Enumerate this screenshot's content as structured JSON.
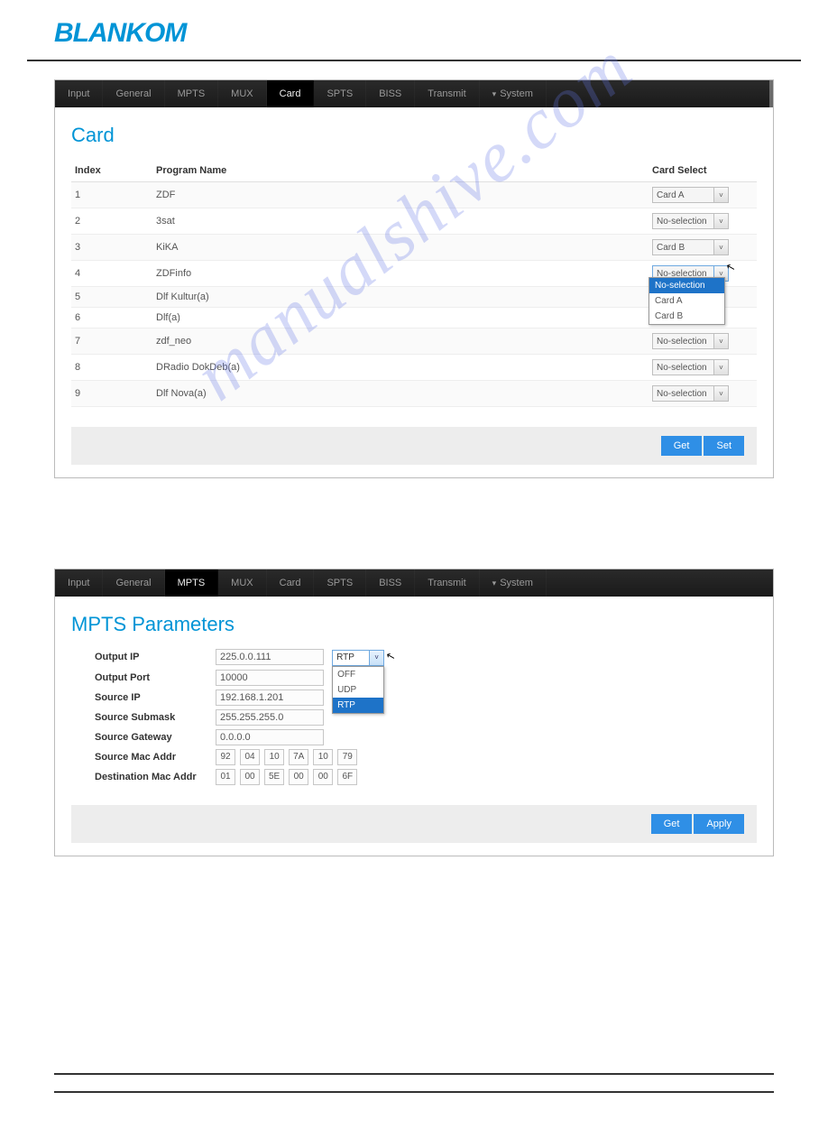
{
  "logo_text": "BLANKOM",
  "watermark": "manualshive.com",
  "screenshot1": {
    "menu": {
      "items": [
        "Input",
        "General",
        "MPTS",
        "MUX",
        "Card",
        "SPTS",
        "BISS",
        "Transmit",
        "System"
      ],
      "active_index": 4
    },
    "title": "Card",
    "headers": {
      "index": "Index",
      "program": "Program Name",
      "select": "Card Select"
    },
    "rows": [
      {
        "index": "1",
        "program": "ZDF",
        "select": "Card A"
      },
      {
        "index": "2",
        "program": "3sat",
        "select": "No-selection"
      },
      {
        "index": "3",
        "program": "KiKA",
        "select": "Card B"
      },
      {
        "index": "4",
        "program": "ZDFinfo",
        "select": "No-selection"
      },
      {
        "index": "5",
        "program": "Dlf Kultur(a)",
        "select": ""
      },
      {
        "index": "6",
        "program": "Dlf(a)",
        "select": ""
      },
      {
        "index": "7",
        "program": "zdf_neo",
        "select": "No-selection"
      },
      {
        "index": "8",
        "program": "DRadio DokDeb(a)",
        "select": "No-selection"
      },
      {
        "index": "9",
        "program": "Dlf Nova(a)",
        "select": "No-selection"
      }
    ],
    "dropdown_options": [
      "No-selection",
      "Card A",
      "Card B"
    ],
    "buttons": {
      "get": "Get",
      "set": "Set"
    }
  },
  "screenshot2": {
    "menu": {
      "items": [
        "Input",
        "General",
        "MPTS",
        "MUX",
        "Card",
        "SPTS",
        "BISS",
        "Transmit",
        "System"
      ],
      "active_index": 2
    },
    "title": "MPTS Parameters",
    "fields": {
      "output_ip": {
        "label": "Output IP",
        "value": "225.0.0.111"
      },
      "output_port": {
        "label": "Output Port",
        "value": "10000"
      },
      "source_ip": {
        "label": "Source IP",
        "value": "192.168.1.201"
      },
      "submask": {
        "label": "Source Submask",
        "value": "255.255.255.0"
      },
      "gateway": {
        "label": "Source Gateway",
        "value": "0.0.0.0"
      },
      "src_mac": {
        "label": "Source Mac Addr",
        "octets": [
          "92",
          "04",
          "10",
          "7A",
          "10",
          "79"
        ]
      },
      "dst_mac": {
        "label": "Destination Mac Addr",
        "octets": [
          "01",
          "00",
          "5E",
          "00",
          "00",
          "6F"
        ]
      }
    },
    "protocol": {
      "selected": "RTP",
      "options": [
        "OFF",
        "UDP",
        "RTP"
      ]
    },
    "buttons": {
      "get": "Get",
      "apply": "Apply"
    }
  }
}
